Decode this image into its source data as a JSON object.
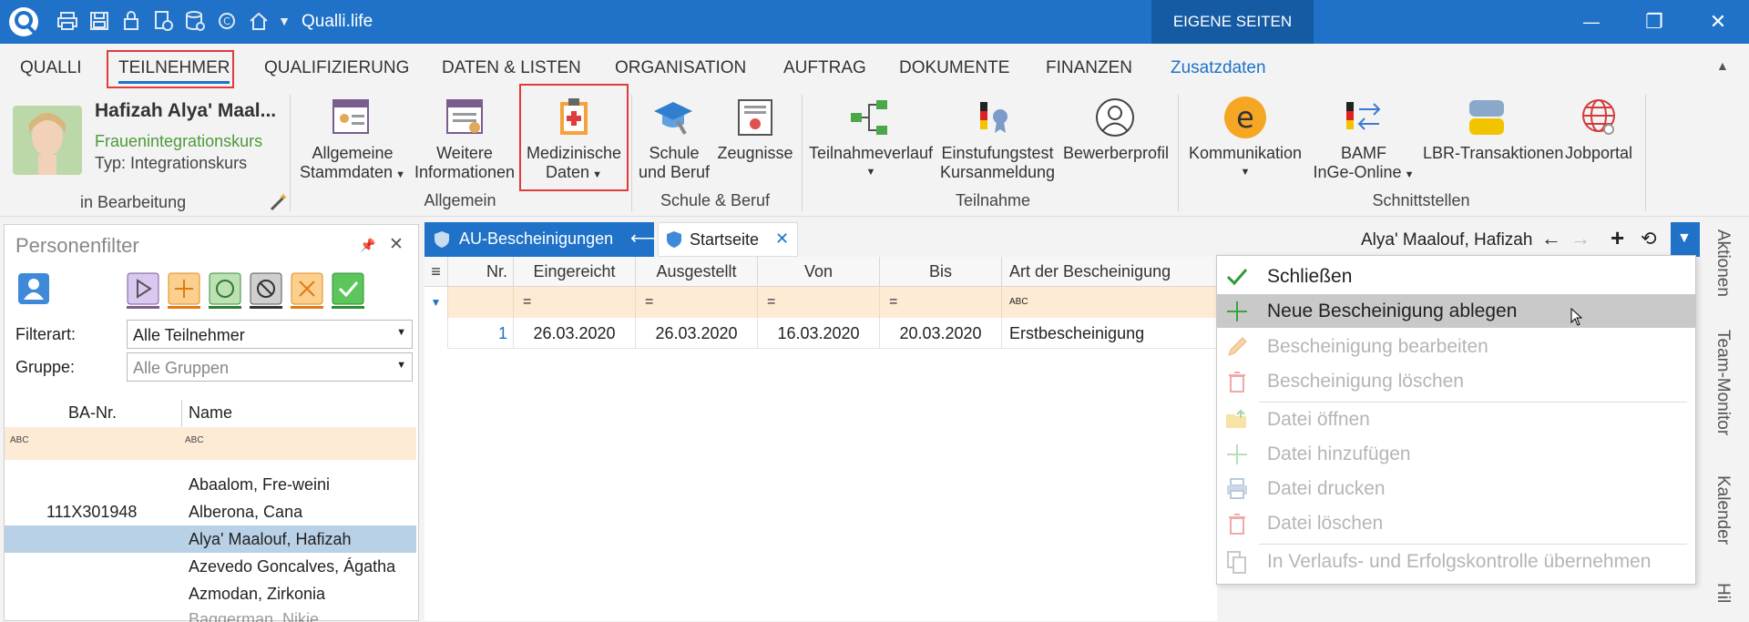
{
  "titlebar": {
    "app_title": "Qualli.life",
    "eigene_seiten": "EIGENE SEITEN",
    "minimize": "—",
    "restore": "❐",
    "close": "✕"
  },
  "menu": {
    "items": [
      "QUALLI",
      "TEILNEHMER",
      "QUALIFIZIERUNG",
      "DATEN & LISTEN",
      "ORGANISATION",
      "AUFTRAG",
      "DOKUMENTE",
      "FINANZEN",
      "Zusatzdaten"
    ],
    "accent": "#1f72c7",
    "highlight_border": "#e03c3c"
  },
  "profile": {
    "name": "Hafizah Alya' Maal...",
    "course": "Frauenintegrationskurs",
    "type": "Typ: Integrationskurs",
    "status": "in Bearbeitung"
  },
  "ribbon": {
    "allgemein": {
      "group_label": "Allgemein",
      "stammdaten": [
        "Allgemeine",
        "Stammdaten"
      ],
      "weitere": [
        "Weitere",
        "Informationen"
      ],
      "medizinische": [
        "Medizinische",
        "Daten"
      ]
    },
    "schule": {
      "group_label": "Schule & Beruf",
      "schule_beruf": [
        "Schule",
        "und Beruf"
      ],
      "zeugnisse": "Zeugnisse"
    },
    "teilnahme": {
      "group_label": "Teilnahme",
      "verlauf": "Teilnahmeverlauf",
      "einstufung": [
        "Einstufungstest",
        "Kursanmeldung"
      ],
      "bewerber": "Bewerberprofil"
    },
    "schnittstellen": {
      "group_label": "Schnittstellen",
      "kommunikation": "Kommunikation",
      "bamf": [
        "BAMF",
        "InGe-Online"
      ],
      "lbr": "LBR-Transaktionen",
      "jobportal": "Jobportal"
    }
  },
  "personenfilter": {
    "title": "Personenfilter",
    "filterart_label": "Filterart:",
    "filterart_value": "Alle Teilnehmer",
    "gruppe_label": "Gruppe:",
    "gruppe_placeholder": "Alle Gruppen",
    "columns": [
      "BA-Nr.",
      "Name"
    ],
    "rows": [
      {
        "ba": "",
        "name": "Abaalom, Fre-weini"
      },
      {
        "ba": "111X301948",
        "name": "Alberona, Cana"
      },
      {
        "ba": "",
        "name": "Alya' Maalouf, Hafizah"
      },
      {
        "ba": "",
        "name": "Azevedo Goncalves, Ágatha"
      },
      {
        "ba": "",
        "name": "Azmodan, Zirkonia"
      },
      {
        "ba": "",
        "name": "Baggerman, Nikie"
      }
    ],
    "selected_index": 2
  },
  "tabs": {
    "active": "AU-Bescheinigungen",
    "second": "Startseite",
    "person": "Alya' Maalouf, Hafizah"
  },
  "grid": {
    "columns": [
      "Nr.",
      "Eingereicht",
      "Ausgestellt",
      "Von",
      "Bis",
      "Art der Bescheinigung"
    ],
    "filter_symbols": [
      "",
      "=",
      "=",
      "=",
      "=",
      "ABC"
    ],
    "rows": [
      [
        "1",
        "26.03.2020",
        "26.03.2020",
        "16.03.2020",
        "20.03.2020",
        "Erstbescheinigung"
      ]
    ]
  },
  "context_menu": {
    "items": [
      {
        "label": "Schließen",
        "icon": "check-icon",
        "disabled": false
      },
      {
        "label": "Neue Bescheinigung ablegen",
        "icon": "plus-icon",
        "disabled": false
      },
      {
        "label": "Bescheinigung bearbeiten",
        "icon": "pencil-icon",
        "disabled": true
      },
      {
        "label": "Bescheinigung löschen",
        "icon": "trash-icon",
        "disabled": true
      },
      {
        "label": "Datei öffnen",
        "icon": "folder-open-icon",
        "disabled": true
      },
      {
        "label": "Datei hinzufügen",
        "icon": "plus-icon",
        "disabled": true
      },
      {
        "label": "Datei drucken",
        "icon": "printer-icon",
        "disabled": true
      },
      {
        "label": "Datei löschen",
        "icon": "trash-icon",
        "disabled": true
      },
      {
        "label": "In Verlaufs- und Erfolgskontrolle übernehmen",
        "icon": "copy-icon",
        "disabled": true
      }
    ]
  },
  "side_tabs": [
    "Aktionen",
    "Team-Monitor",
    "Kalender",
    "Hil"
  ]
}
